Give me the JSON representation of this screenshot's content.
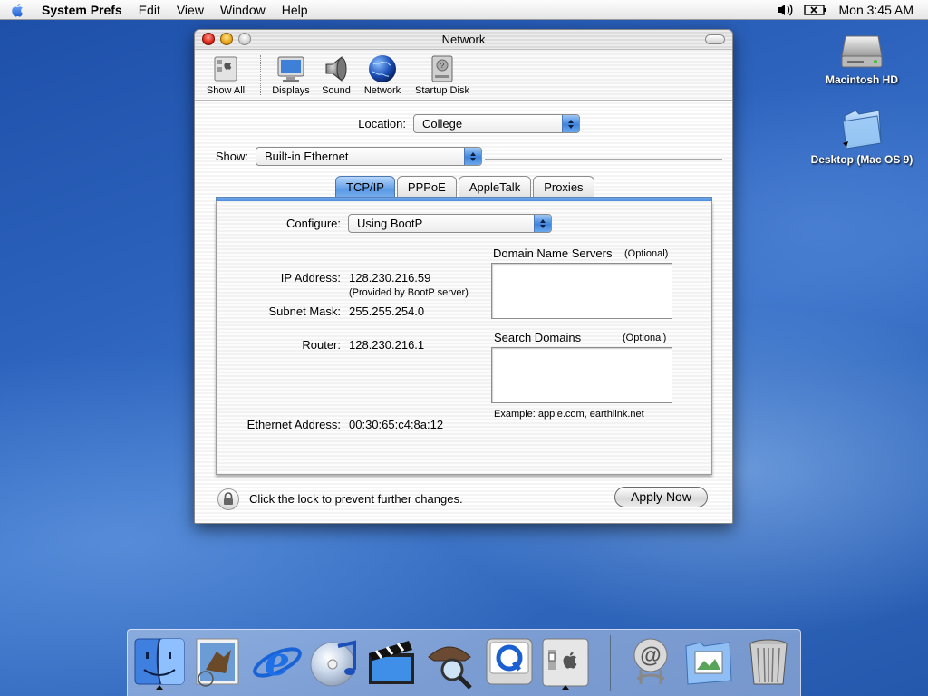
{
  "menubar": {
    "app": "System Prefs",
    "items": [
      "Edit",
      "View",
      "Window",
      "Help"
    ],
    "clock": "Mon 3:45 AM"
  },
  "desktop": {
    "icons": [
      {
        "label": "Macintosh HD",
        "icon": "hard-drive-icon"
      },
      {
        "label": "Desktop (Mac OS 9)",
        "icon": "folder-icon"
      }
    ]
  },
  "window": {
    "title": "Network",
    "toolbar": {
      "show_all": "Show All",
      "items": [
        "Displays",
        "Sound",
        "Network",
        "Startup Disk"
      ]
    },
    "location": {
      "label": "Location:",
      "value": "College"
    },
    "show": {
      "label": "Show:",
      "value": "Built-in Ethernet"
    },
    "tabs": [
      "TCP/IP",
      "PPPoE",
      "AppleTalk",
      "Proxies"
    ],
    "active_tab": "TCP/IP",
    "tcpip": {
      "configure_label": "Configure:",
      "configure_value": "Using BootP",
      "ip_label": "IP Address:",
      "ip_value": "128.230.216.59",
      "ip_note": "(Provided by BootP server)",
      "subnet_label": "Subnet Mask:",
      "subnet_value": "255.255.254.0",
      "router_label": "Router:",
      "router_value": "128.230.216.1",
      "ethernet_label": "Ethernet Address:",
      "ethernet_value": "00:30:65:c4:8a:12",
      "dns_label": "Domain Name Servers",
      "dns_optional": "(Optional)",
      "search_label": "Search Domains",
      "search_optional": "(Optional)",
      "example": "Example: apple.com, earthlink.net"
    },
    "lock_text": "Click the lock to prevent further changes.",
    "apply_button": "Apply Now"
  },
  "dock": {
    "items": [
      "finder-icon",
      "mail-icon",
      "internet-explorer-icon",
      "itunes-icon",
      "imovie-icon",
      "sherlock-icon",
      "quicktime-icon",
      "system-preferences-icon",
      "mail-at-icon",
      "documents-folder-icon",
      "trash-icon"
    ]
  }
}
